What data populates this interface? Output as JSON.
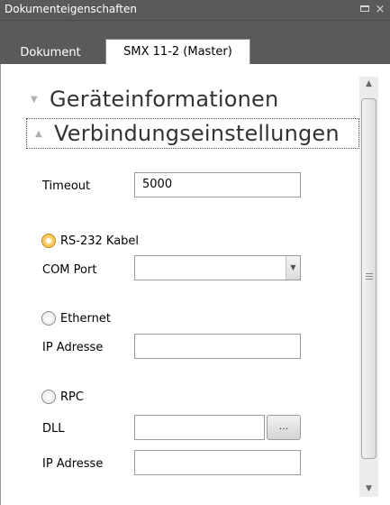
{
  "window": {
    "title": "Dokumenteigenschaften",
    "maximize_icon": "maximize-icon",
    "close_label": "×"
  },
  "tabs": [
    {
      "label": "Dokument",
      "selected": false
    },
    {
      "label": "SMX 11-2 (Master)",
      "selected": true
    }
  ],
  "sections": {
    "geraete": {
      "label": "Geräteinformationen",
      "expanded": false
    },
    "verbindung": {
      "label": "Verbindungseinstellungen",
      "expanded": true
    }
  },
  "connection": {
    "timeout_label": "Timeout",
    "timeout_value": "5000",
    "rs232": {
      "label": "RS-232 Kabel",
      "selected": true
    },
    "com_port_label": "COM Port",
    "com_port_value": "",
    "ethernet": {
      "label": "Ethernet",
      "selected": false
    },
    "ethernet_ip_label": "IP Adresse",
    "ethernet_ip_value": "",
    "rpc": {
      "label": "RPC",
      "selected": false
    },
    "dll_label": "DLL",
    "dll_value": "",
    "browse_label": "...",
    "rpc_ip_label": "IP Adresse",
    "rpc_ip_value": ""
  },
  "colors": {
    "titlebar": "#5a5a5a",
    "radio_selected": "#f0b436",
    "tab_active_bg": "#ffffff"
  }
}
